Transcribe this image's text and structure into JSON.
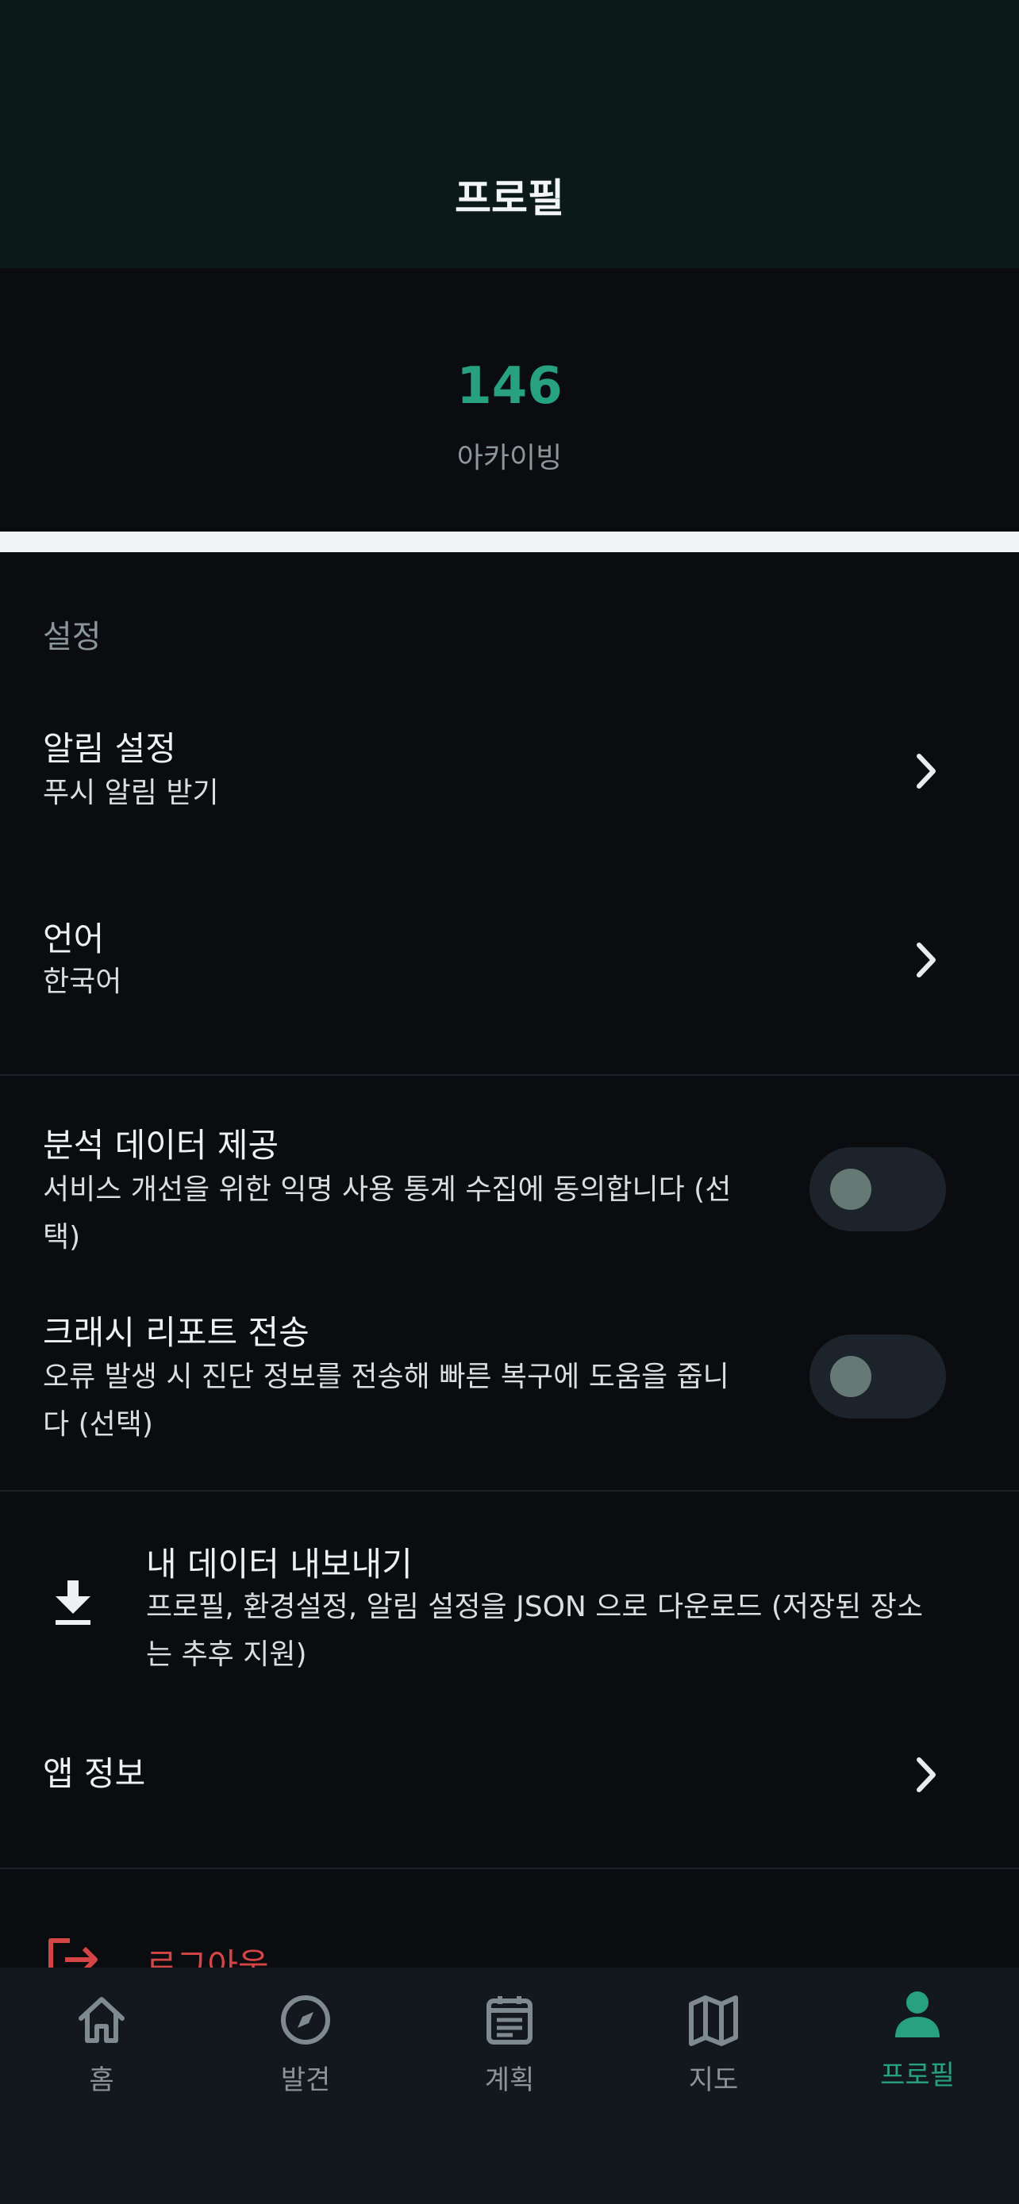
{
  "header": {
    "title": "프로필"
  },
  "stats": {
    "value": "146",
    "label": "아카이빙"
  },
  "settings": {
    "section_title": "설정",
    "notifications": {
      "title": "알림 설정",
      "subtitle": "푸시 알림 받기"
    },
    "language": {
      "title": "언어",
      "value": "한국어"
    },
    "analytics": {
      "title": "분석 데이터 제공",
      "desc_line1": "서비스 개선을 위한 익명 사용 통계 수집에 동의합니다 (선",
      "desc_line2": "택)",
      "enabled": false
    },
    "crash": {
      "title": "크래시 리포트 전송",
      "desc_line1": "오류 발생 시 진단 정보를 전송해 빠른 복구에 도움을 줍니",
      "desc_line2": "다 (선택)",
      "enabled": false
    },
    "export": {
      "title": "내 데이터 내보내기",
      "desc_line1": "프로필, 환경설정, 알림 설정을 JSON 으로 다운로드 (저장된 장소",
      "desc_line2": "는 추후 지원)"
    },
    "about": {
      "title": "앱 정보"
    },
    "logout": {
      "label": "로그아웃"
    }
  },
  "tabbar": {
    "items": [
      {
        "label": "홈",
        "icon": "home-icon"
      },
      {
        "label": "발견",
        "icon": "compass-icon"
      },
      {
        "label": "계획",
        "icon": "calendar-icon"
      },
      {
        "label": "지도",
        "icon": "map-icon"
      },
      {
        "label": "프로필",
        "icon": "person-icon",
        "active": true
      }
    ]
  },
  "colors": {
    "accent": "#27a17f",
    "logout": "#d64545",
    "background": "#0a0c10",
    "header": "#0b1a19"
  }
}
